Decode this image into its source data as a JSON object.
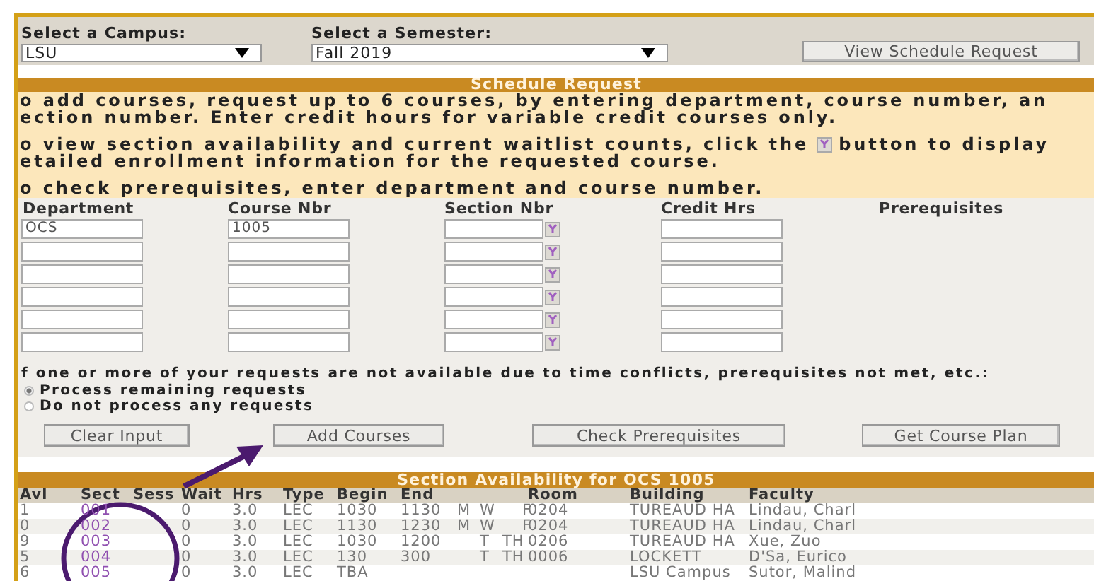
{
  "campus": {
    "label": "Select a Campus:",
    "value": "LSU"
  },
  "semester": {
    "label": "Select a Semester:",
    "value": "Fall 2019"
  },
  "view_button": "View Schedule Request",
  "request": {
    "title": "Schedule Request",
    "paragraphs": [
      {
        "lines": [
          {
            "text": "o add courses, request up to 6 courses, by entering department, course number, an"
          },
          {
            "text": "ection number. Enter credit hours for variable credit courses only."
          }
        ]
      },
      {
        "lines": [
          {
            "text": "o view section availability and current waitlist counts, click the",
            "after": "button to display"
          },
          {
            "text": "etailed enrollment information for the requested course."
          }
        ]
      },
      {
        "lines": [
          {
            "text": "o check prerequisites, enter department and course number."
          }
        ]
      }
    ]
  },
  "form": {
    "columns": [
      "Department",
      "Course Nbr",
      "Section Nbr",
      "Credit Hrs",
      "Prerequisites"
    ],
    "rows": [
      {
        "department": "OCS",
        "course_nbr": "1005"
      },
      {},
      {},
      {},
      {},
      {}
    ]
  },
  "conflict_note": "f one or more of your requests are not available due to time conflicts, prerequisites not met, etc.:",
  "options": [
    {
      "label": "Process remaining requests",
      "selected": true
    },
    {
      "label": "Do not process any requests",
      "selected": false
    }
  ],
  "buttons": [
    "Clear Input",
    "Add Courses",
    "Check Prerequisites",
    "Get Course Plan"
  ],
  "availability": {
    "title": "Section Availability for OCS 1005",
    "columns": {
      "avl": "Avl",
      "sect": "Sect",
      "sess": "Sess",
      "wait": "Wait",
      "hrs": "Hrs",
      "type": "Type",
      "begin": "Begin",
      "end": "End",
      "room": "Room",
      "building": "Building",
      "faculty": "Faculty"
    },
    "rows": [
      {
        "avl": "1",
        "sect": "001",
        "wait": "0",
        "hrs": "3.0",
        "type": "LEC",
        "begin": "1030",
        "end": "1130",
        "days": {
          "mon": "M",
          "wed": "W",
          "fri": "F"
        },
        "room": "0204",
        "building": "TUREAUD HA",
        "faculty": "Lindau, Charl"
      },
      {
        "avl": "0",
        "sect": "002",
        "wait": "0",
        "hrs": "3.0",
        "type": "LEC",
        "begin": "1130",
        "end": "1230",
        "days": {
          "mon": "M",
          "wed": "W",
          "fri": "F"
        },
        "room": "0204",
        "building": "TUREAUD HA",
        "faculty": "Lindau, Charl"
      },
      {
        "avl": "9",
        "sect": "003",
        "wait": "0",
        "hrs": "3.0",
        "type": "LEC",
        "begin": "1030",
        "end": "1200",
        "days": {
          "tue": "T",
          "thu": "TH"
        },
        "room": "0206",
        "building": "TUREAUD HA",
        "faculty": "Xue, Zuo"
      },
      {
        "avl": "5",
        "sect": "004",
        "wait": "0",
        "hrs": "3.0",
        "type": "LEC",
        "begin": "130",
        "end": "300",
        "days": {
          "tue": "T",
          "thu": "TH"
        },
        "room": "0006",
        "building": "LOCKETT",
        "faculty": "D'Sa, Eurico"
      },
      {
        "avl": "6",
        "sect": "005",
        "wait": "0",
        "hrs": "3.0",
        "type": "LEC",
        "begin": "TBA",
        "building": "LSU Campus",
        "faculty": "Sutor, Malind"
      }
    ]
  }
}
